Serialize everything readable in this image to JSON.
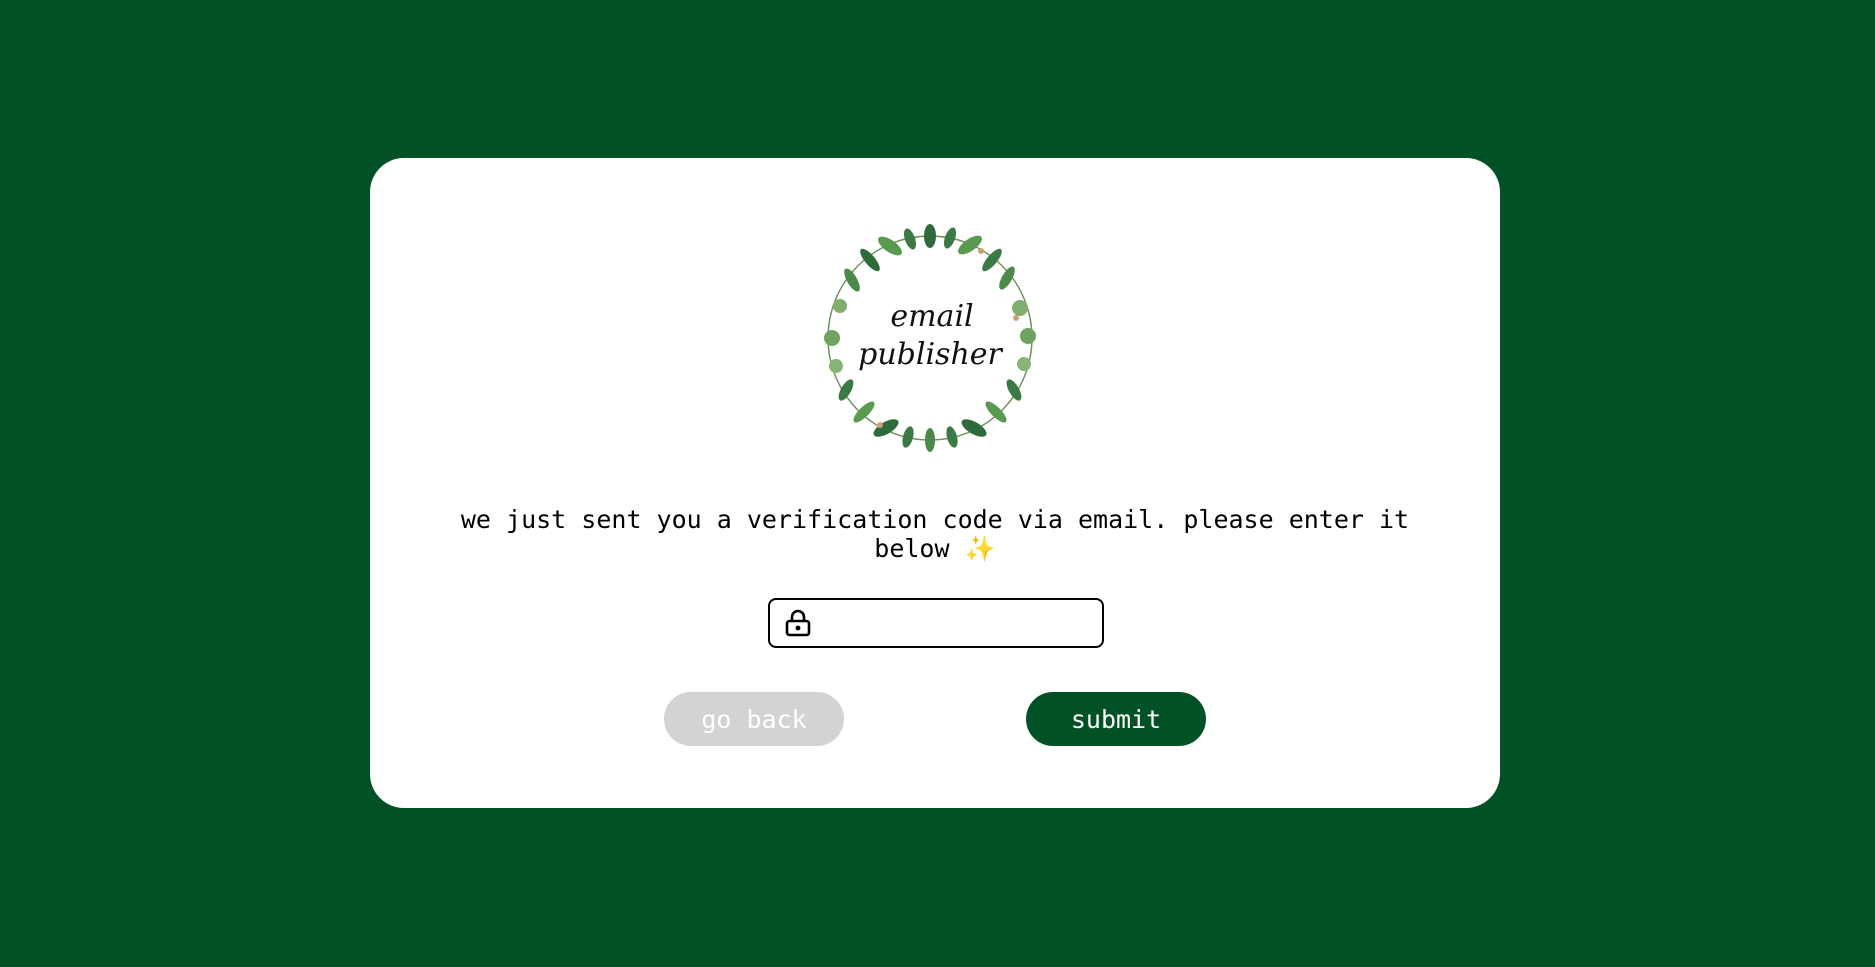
{
  "colors": {
    "page_background": "#005226",
    "card_background": "#ffffff",
    "accent": "#005226",
    "disabled_button": "#d3d3d3",
    "button_text": "#ffffff",
    "text": "#000000"
  },
  "logo": {
    "line1": "email",
    "line2": "publisher"
  },
  "message": "we just sent you a verification code via email. please enter it below ✨",
  "code_field": {
    "value": "",
    "placeholder": "",
    "icon": "lock-icon"
  },
  "buttons": {
    "back_label": "go back",
    "submit_label": "submit"
  }
}
